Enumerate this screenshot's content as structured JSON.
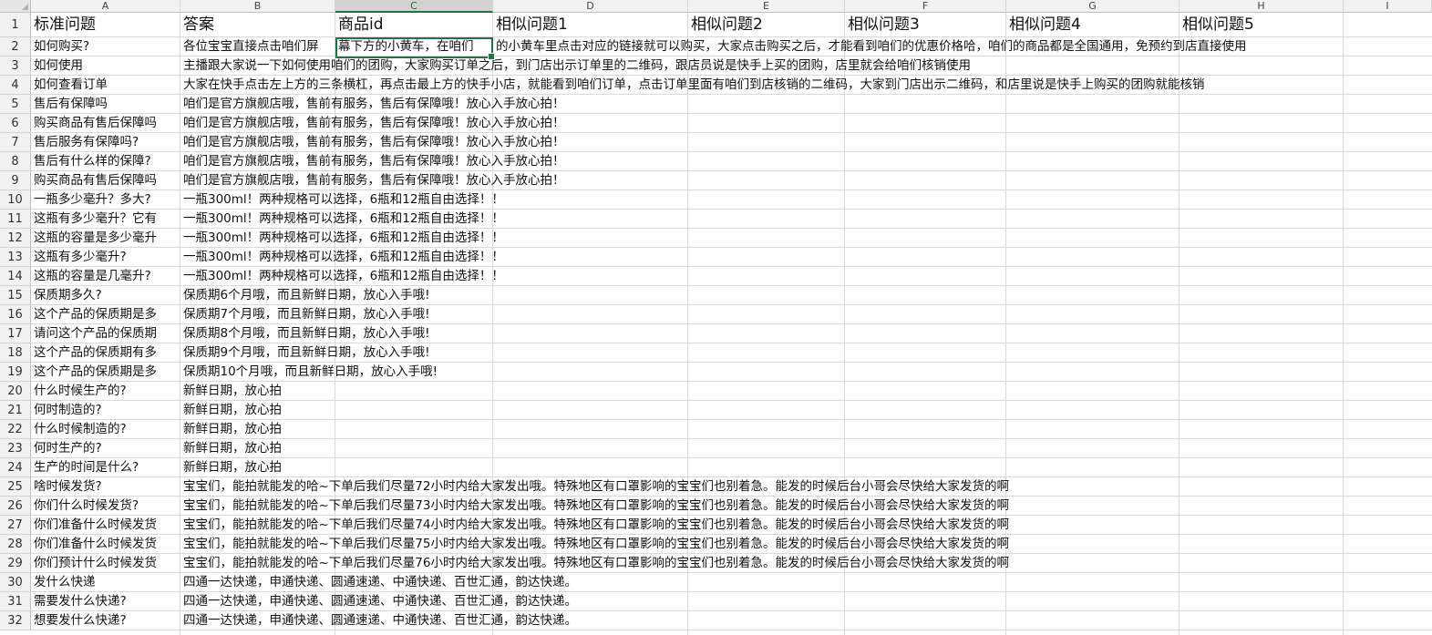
{
  "columns": [
    "A",
    "B",
    "C",
    "D",
    "E",
    "F",
    "G",
    "H",
    "I"
  ],
  "active_column": "C",
  "active_cell": "C2",
  "rows": [
    {
      "num": "1",
      "a": "标准问题",
      "b": "答案",
      "c": "商品id",
      "d": "相似问题1",
      "e": "相似问题2",
      "f": "相似问题3",
      "g": "相似问题4",
      "h": "相似问题5"
    },
    {
      "num": "2",
      "a": "如何购买?",
      "b": "各位宝宝直接点击咱们屏",
      "c": "幕下方的小黄车，在咱们",
      "d": "的小黄车里点击对应的链接就可以购买，大家点击购买之后，才能看到咱们的优惠价格哈，咱们的商品都是全国通用，免预约到店直接使用"
    },
    {
      "num": "3",
      "a": "如何使用",
      "b": "主播跟大家说一下如何使用咱们的团购，大家购买订单之后，到门店出示订单里的二维码，跟店员说是快手上买的团购，店里就会给咱们核销使用"
    },
    {
      "num": "4",
      "a": "如何查看订单",
      "b": "大家在快手点击左上方的三条横杠，再点击最上方的快手小店，就能看到咱们订单，点击订单里面有咱们到店核销的二维码，大家到门店出示二维码，和店里说是快手上购买的团购就能核销"
    },
    {
      "num": "5",
      "a": "售后有保障吗",
      "b": "咱们是官方旗舰店哦，售前有服务，售后有保障哦！放心入手放心拍！"
    },
    {
      "num": "6",
      "a": "购买商品有售后保障吗",
      "b": "咱们是官方旗舰店哦，售前有服务，售后有保障哦！放心入手放心拍！"
    },
    {
      "num": "7",
      "a": "售后服务有保障吗?",
      "b": "咱们是官方旗舰店哦，售前有服务，售后有保障哦！放心入手放心拍！"
    },
    {
      "num": "8",
      "a": "售后有什么样的保障?",
      "b": "咱们是官方旗舰店哦，售前有服务，售后有保障哦！放心入手放心拍！"
    },
    {
      "num": "9",
      "a": "购买商品有售后保障吗",
      "b": "咱们是官方旗舰店哦，售前有服务，售后有保障哦！放心入手放心拍！"
    },
    {
      "num": "10",
      "a": "一瓶多少毫升？多大?",
      "b": "一瓶300ml！两种规格可以选择，6瓶和12瓶自由选择！！"
    },
    {
      "num": "11",
      "a": "这瓶有多少毫升？它有",
      "b": "一瓶300ml！两种规格可以选择，6瓶和12瓶自由选择！！"
    },
    {
      "num": "12",
      "a": "这瓶的容量是多少毫升",
      "b": "一瓶300ml！两种规格可以选择，6瓶和12瓶自由选择！！"
    },
    {
      "num": "13",
      "a": "这瓶有多少毫升?",
      "b": "一瓶300ml！两种规格可以选择，6瓶和12瓶自由选择！！"
    },
    {
      "num": "14",
      "a": "这瓶的容量是几毫升?",
      "b": "一瓶300ml！两种规格可以选择，6瓶和12瓶自由选择！！"
    },
    {
      "num": "15",
      "a": "保质期多久?",
      "b": "保质期6个月哦，而且新鲜日期，放心入手哦!"
    },
    {
      "num": "16",
      "a": "这个产品的保质期是多",
      "b": "保质期7个月哦，而且新鲜日期，放心入手哦!"
    },
    {
      "num": "17",
      "a": "请问这个产品的保质期",
      "b": "保质期8个月哦，而且新鲜日期，放心入手哦!"
    },
    {
      "num": "18",
      "a": "这个产品的保质期有多",
      "b": "保质期9个月哦，而且新鲜日期，放心入手哦!"
    },
    {
      "num": "19",
      "a": "这个产品的保质期是多",
      "b": "保质期10个月哦，而且新鲜日期，放心入手哦!"
    },
    {
      "num": "20",
      "a": "什么时候生产的?",
      "b": "新鲜日期，放心拍"
    },
    {
      "num": "21",
      "a": "何时制造的?",
      "b": "新鲜日期，放心拍"
    },
    {
      "num": "22",
      "a": "什么时候制造的?",
      "b": "新鲜日期，放心拍"
    },
    {
      "num": "23",
      "a": "何时生产的?",
      "b": "新鲜日期，放心拍"
    },
    {
      "num": "24",
      "a": "生产的时间是什么?",
      "b": "新鲜日期，放心拍"
    },
    {
      "num": "25",
      "a": "啥时候发货?",
      "b": "宝宝们，能拍就能发的哈~下单后我们尽量72小时内给大家发出哦。特殊地区有口罩影响的宝宝们也别着急。能发的时候后台小哥会尽快给大家发货的啊"
    },
    {
      "num": "26",
      "a": "你们什么时候发货?",
      "b": "宝宝们，能拍就能发的哈~下单后我们尽量73小时内给大家发出哦。特殊地区有口罩影响的宝宝们也别着急。能发的时候后台小哥会尽快给大家发货的啊"
    },
    {
      "num": "27",
      "a": "你们准备什么时候发货",
      "b": "宝宝们，能拍就能发的哈~下单后我们尽量74小时内给大家发出哦。特殊地区有口罩影响的宝宝们也别着急。能发的时候后台小哥会尽快给大家发货的啊"
    },
    {
      "num": "28",
      "a": "你们准备什么时候发货",
      "b": "宝宝们，能拍就能发的哈~下单后我们尽量75小时内给大家发出哦。特殊地区有口罩影响的宝宝们也别着急。能发的时候后台小哥会尽快给大家发货的啊"
    },
    {
      "num": "29",
      "a": "你们预计什么时候发货",
      "b": "宝宝们，能拍就能发的哈~下单后我们尽量76小时内给大家发出哦。特殊地区有口罩影响的宝宝们也别着急。能发的时候后台小哥会尽快给大家发货的啊"
    },
    {
      "num": "30",
      "a": "发什么快递",
      "b": "四通一达快递，申通快递、圆通速递、中通快递、百世汇通，韵达快递。"
    },
    {
      "num": "31",
      "a": "需要发什么快递?",
      "b": "四通一达快递，申通快递、圆通速递、中通快递、百世汇通，韵达快递。"
    },
    {
      "num": "32",
      "a": "想要发什么快递?",
      "b": "四通一达快递，申通快递、圆通速递、中通快递、百世汇通，韵达快递。"
    }
  ]
}
